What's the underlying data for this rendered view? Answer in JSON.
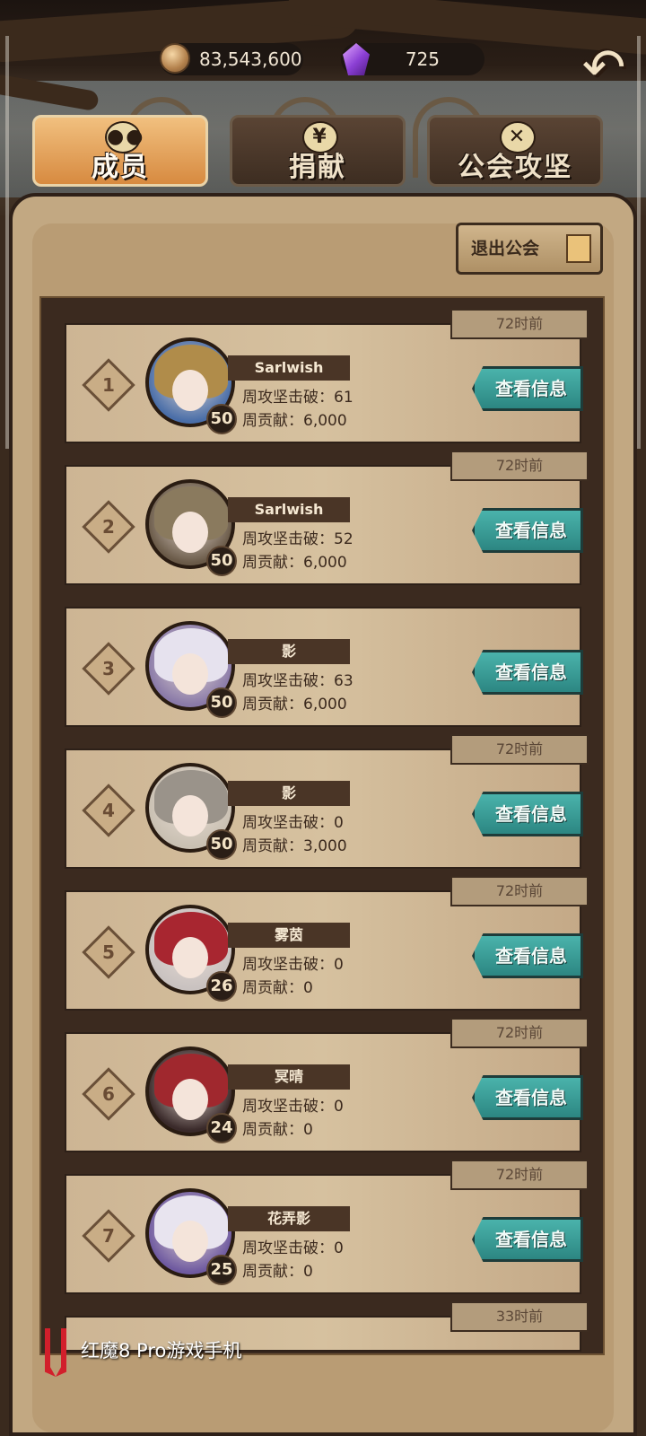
{
  "currencies": {
    "gold": "83,543,600",
    "gems": "725"
  },
  "back_label": "↶",
  "tabs": [
    {
      "label": "成员",
      "icon_glyph": "●●",
      "active": true
    },
    {
      "label": "捐献",
      "icon_glyph": "¥",
      "active": false
    },
    {
      "label": "公会攻坚",
      "icon_glyph": "✕",
      "active": false
    }
  ],
  "leave_button": "退出公会",
  "members": [
    {
      "rank": "1",
      "name": "Sarlwish",
      "level": "50",
      "time": "72时前",
      "weekly_breaks_label": "周攻坚击破：61",
      "weekly_contrib_label": "周贡献：6,000",
      "button": "查看信息",
      "hood": "#b08c4a",
      "bg": "#4a6ea8"
    },
    {
      "rank": "2",
      "name": "Sarlwish",
      "level": "50",
      "time": "72时前",
      "weekly_breaks_label": "周攻坚击破：52",
      "weekly_contrib_label": "周贡献：6,000",
      "button": "查看信息",
      "hood": "#8a7a5e",
      "bg": "#6a5a48"
    },
    {
      "rank": "3",
      "name": "影",
      "level": "50",
      "time": "",
      "weekly_breaks_label": "周攻坚击破：63",
      "weekly_contrib_label": "周贡献：6,000",
      "button": "查看信息",
      "hood": "#e6e2ee",
      "bg": "#8a7aa8"
    },
    {
      "rank": "4",
      "name": "影",
      "level": "50",
      "time": "72时前",
      "weekly_breaks_label": "周攻坚击破：0",
      "weekly_contrib_label": "周贡献：3,000",
      "button": "查看信息",
      "hood": "#9a938a",
      "bg": "#c9c0b2"
    },
    {
      "rank": "5",
      "name": "雾茵",
      "level": "26",
      "time": "72时前",
      "weekly_breaks_label": "周攻坚击破：0",
      "weekly_contrib_label": "周贡献：0",
      "button": "查看信息",
      "hood": "#a82630",
      "bg": "#c9c2c0"
    },
    {
      "rank": "6",
      "name": "冥晴",
      "level": "24",
      "time": "72时前",
      "weekly_breaks_label": "周攻坚击破：0",
      "weekly_contrib_label": "周贡献：0",
      "button": "查看信息",
      "hood": "#a0282e",
      "bg": "#3a2a2a"
    },
    {
      "rank": "7",
      "name": "花弄影",
      "level": "25",
      "time": "72时前",
      "weekly_breaks_label": "周攻坚击破：0",
      "weekly_contrib_label": "周贡献：0",
      "button": "查看信息",
      "hood": "#e8e4ef",
      "bg": "#6f5aa0"
    }
  ],
  "next_time": "33时前",
  "watermark": "红魔8 Pro游戏手机"
}
